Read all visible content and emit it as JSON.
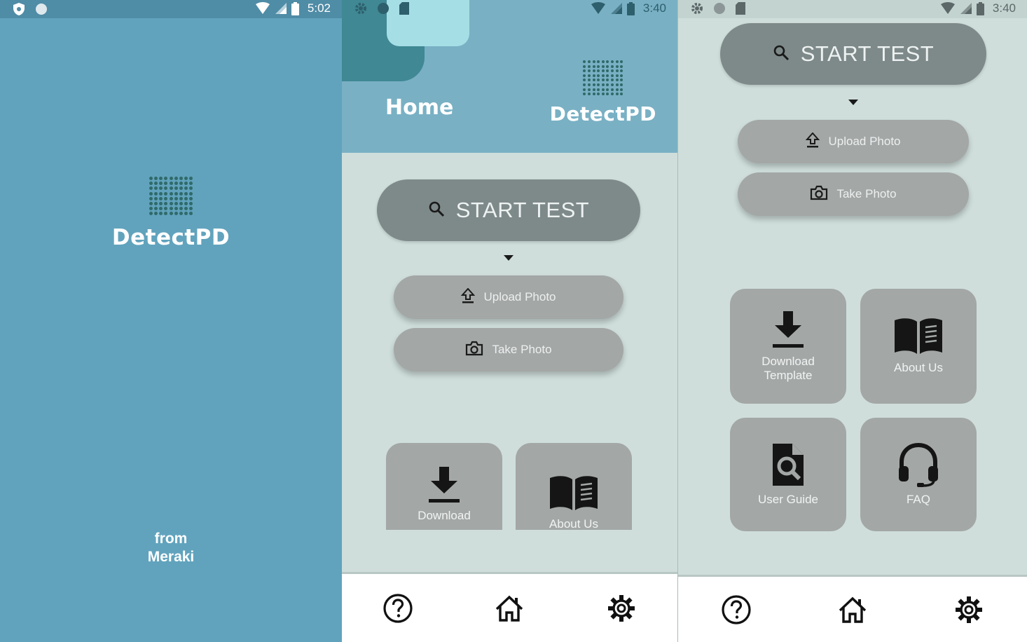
{
  "colors": {
    "splash_bg": "#61a3bd",
    "header_bg": "#79b0c4",
    "content_bg": "#cfdedb",
    "start_button": "#7e8a89",
    "secondary_button": "#a3a7a6",
    "logo_dots": "#2f6a69"
  },
  "splash": {
    "status_time": "5:02",
    "brand": "DetectPD",
    "from_line1": "from",
    "from_line2": "Meraki"
  },
  "home": {
    "status_time": "3:40",
    "title": "Home",
    "brand": "DetectPD",
    "start_test_label": "START TEST",
    "upload_photo_label": "Upload Photo",
    "take_photo_label": "Take Photo",
    "tiles": {
      "download_label": "Download",
      "about_label": "About Us"
    }
  },
  "scrolled": {
    "status_time": "3:40",
    "start_test_label": "START TEST",
    "upload_photo_label": "Upload Photo",
    "take_photo_label": "Take Photo",
    "tiles": {
      "download_line1": "Download",
      "download_line2": "Template",
      "about_label": "About Us",
      "guide_label": "User Guide",
      "faq_label": "FAQ"
    }
  },
  "nav_icons": [
    "help-icon",
    "home-icon",
    "settings-icon"
  ]
}
